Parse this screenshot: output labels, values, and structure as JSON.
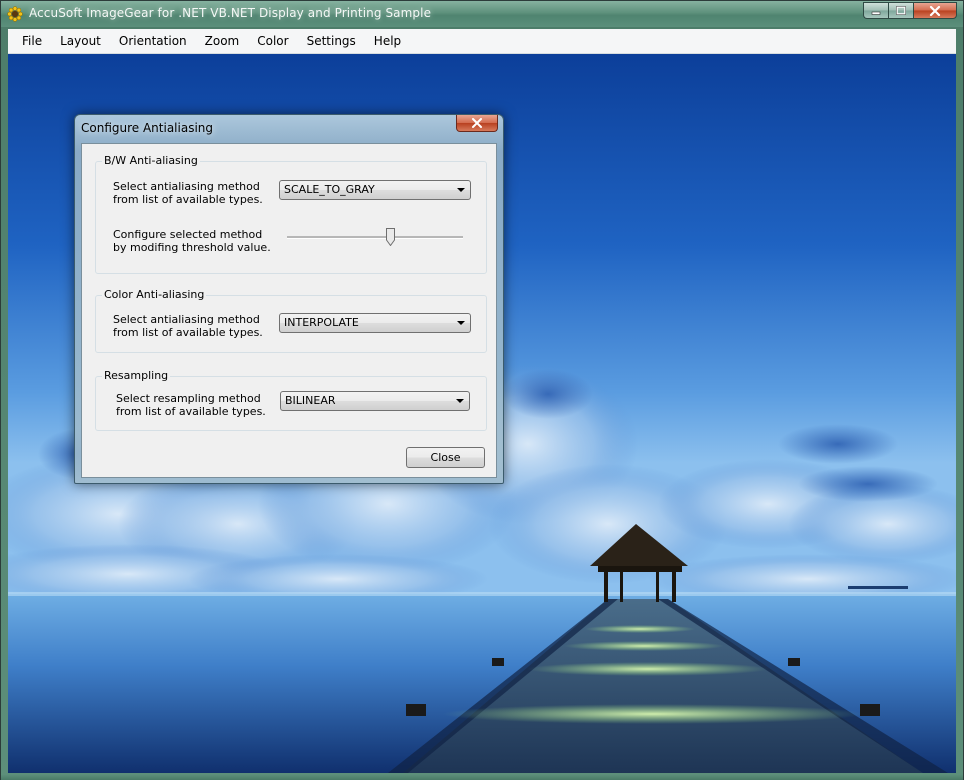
{
  "window": {
    "title": "AccuSoft ImageGear for .NET VB.NET Display and Printing Sample"
  },
  "menu": {
    "items": [
      "File",
      "Layout",
      "Orientation",
      "Zoom",
      "Color",
      "Settings",
      "Help"
    ]
  },
  "dialog": {
    "title": "Configure Antialiasing",
    "bw_group": {
      "label": "B/W Anti-aliasing",
      "method_desc": "Select antialiasing method from list of available types.",
      "method_value": "SCALE_TO_GRAY",
      "threshold_desc": "Configure selected method by modifing threshold value.",
      "threshold_level": 0.59
    },
    "color_group": {
      "label": "Color Anti-aliasing",
      "method_desc": "Select antialiasing method from list of available types.",
      "method_value": "INTERPOLATE"
    },
    "resampling_group": {
      "label": "Resampling",
      "method_desc": "Select resampling method from list of available types.",
      "method_value": "BILINEAR"
    },
    "close_label": "Close"
  },
  "icons": {
    "app": "sunflower-icon",
    "minimize": "minimize-icon",
    "maximize": "maximize-icon",
    "close": "close-icon"
  }
}
